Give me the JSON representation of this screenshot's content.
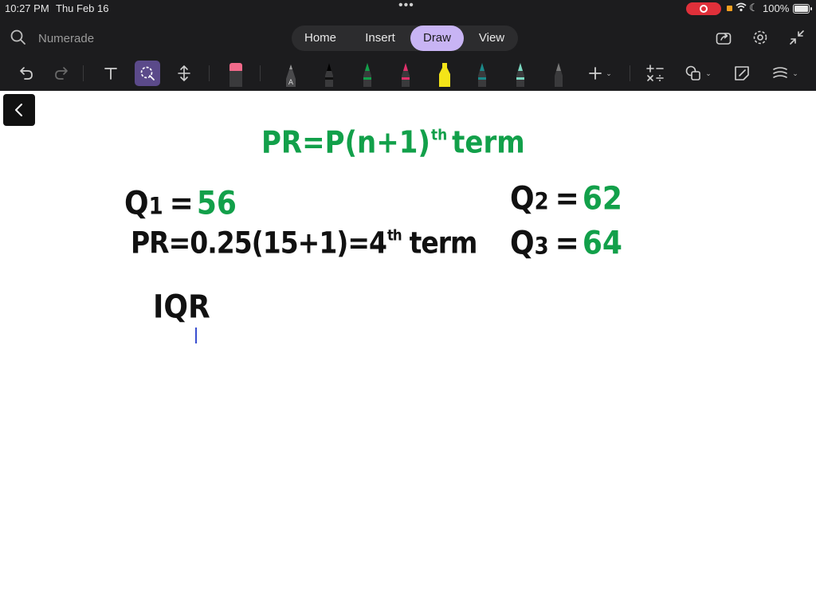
{
  "status_bar": {
    "time": "10:27 PM",
    "date": "Thu Feb 16",
    "dots": "•••",
    "battery": "100%"
  },
  "header": {
    "search_label": "Numerade",
    "tabs": [
      {
        "label": "Home"
      },
      {
        "label": "Insert"
      },
      {
        "label": "Draw",
        "active": true
      },
      {
        "label": "View"
      }
    ],
    "icons": [
      "share-icon",
      "settings-icon",
      "collapse-icon"
    ]
  },
  "toolbar": {
    "tools": [
      "undo-icon",
      "redo-icon",
      "text-icon",
      "lasso-icon",
      "space-icon",
      "eraser-icon",
      "pencil-icon",
      "pen-black-icon",
      "pen-green-icon",
      "pen-pink-icon",
      "highlighter-yellow-icon",
      "pen-teal-icon",
      "pen-mint-icon",
      "pen-gray-icon",
      "add-icon",
      "math-icon",
      "shapes-icon",
      "sticky-note-icon",
      "ruler-icon"
    ],
    "active_tool": "lasso-icon"
  },
  "canvas": {
    "formula": {
      "left": "PR=P(n+1)",
      "sup": "th",
      "right": "term",
      "color": "#12a04a"
    },
    "q1": {
      "label": "Q",
      "sub": "1",
      "eq": "=",
      "value": "56"
    },
    "pr_line": {
      "left": "PR=0.25(15+1)=4",
      "sup": "th",
      "right": "term"
    },
    "q2": {
      "label": "Q",
      "sub": "2",
      "eq": "=",
      "value": "62"
    },
    "q3": {
      "label": "Q",
      "sub": "3",
      "eq": "=",
      "value": "64"
    },
    "iqr": "IQR"
  },
  "colors": {
    "chrome_bg": "#1c1c1e",
    "active_tab": "#c8b4f4",
    "ink_green": "#12a04a",
    "ink_black": "#111111",
    "record": "#e0303a"
  }
}
